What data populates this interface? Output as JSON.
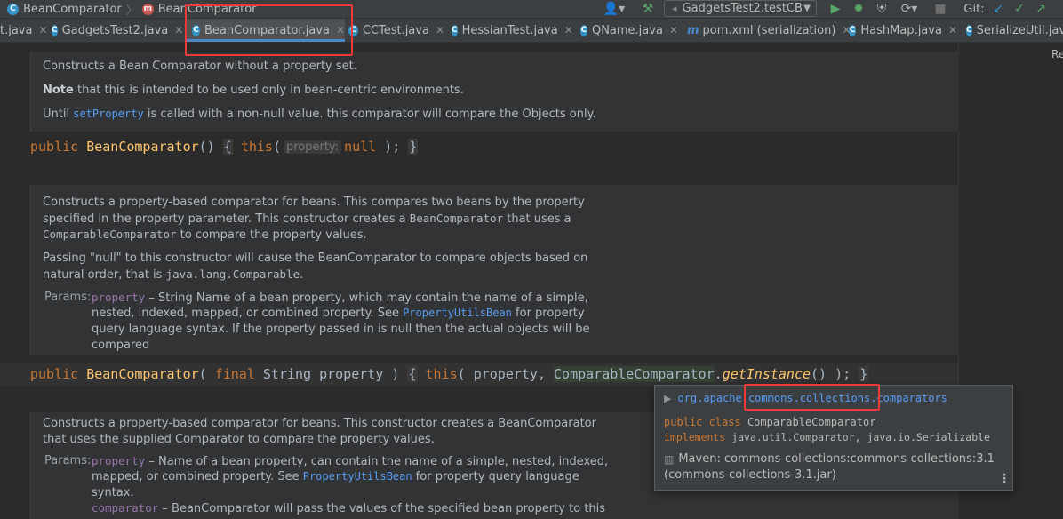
{
  "navbar": {
    "crumb_class": "BeanComparator",
    "crumb_method": "BeanComparator",
    "run_config": "GadgetsTest2.testCB",
    "vcs_label": "Git:"
  },
  "tabs": [
    {
      "label": "t.java"
    },
    {
      "label": "GadgetsTest2.java"
    },
    {
      "label": "BeanComparator.java"
    },
    {
      "label": "CCTest.java"
    },
    {
      "label": "HessianTest.java"
    },
    {
      "label": "QName.java"
    },
    {
      "label": "pom.xml (serialization)"
    },
    {
      "label": "HashMap.java"
    },
    {
      "label": "SerializeUtil.java"
    }
  ],
  "side_panel": {
    "label": "Re"
  },
  "docs": {
    "d1": {
      "line1": "Constructs a Bean Comparator without a property set.",
      "note_bold": "Note",
      "note_rest": " that this is intended to be used only in bean-centric environments.",
      "until": "Until ",
      "link": "setProperty",
      "until_rest": " is called with a non-null value. this comparator will compare the Objects only."
    },
    "d2": {
      "l1": "Constructs a property-based comparator for beans. This compares two beans by the property",
      "l2a": "specified in the property parameter. This constructor creates a ",
      "l2code": "BeanComparator",
      "l2b": " that uses a",
      "l3code": "ComparableComparator",
      "l3b": " to compare the property values.",
      "l4": "Passing \"null\" to this constructor will cause the BeanComparator to compare objects based on",
      "l5a": "natural order, that is ",
      "l5code": "java.lang.Comparable",
      "l5b": ".",
      "params_label": "Params:",
      "p_name": "property",
      "p1": " – String Name of a bean property, which may contain the name of a simple,",
      "p2a": "nested, indexed, mapped, or combined property. See ",
      "p2link": "PropertyUtilsBean",
      "p2b": " for property",
      "p3": "query language syntax. If the property passed in is null then the actual objects will be",
      "p4": "compared"
    },
    "d3": {
      "l1": "Constructs a property-based comparator for beans. This constructor creates a BeanComparator",
      "l2": "that uses the supplied Comparator to compare the property values.",
      "params_label": "Params:",
      "p_name": "property",
      "p1": " – Name of a bean property, can contain the name of a simple, nested, indexed,",
      "p2a": "mapped, or combined property. See ",
      "p2link": "PropertyUtilsBean",
      "p2b": " for property query language",
      "p3": "syntax.",
      "p4name": "comparator",
      "p4": " – BeanComparator will pass the values of the specified bean property to this"
    }
  },
  "code": {
    "line1": {
      "kw_public": "public",
      "name": "BeanComparator",
      "paren": "()",
      "lbrace": "{",
      "kw_this": "this",
      "open": "(",
      "hint": "property:",
      "kw_null": "null",
      "close": ");",
      "rbrace": "}"
    },
    "line2": {
      "kw_public": "public",
      "name": "BeanComparator",
      "open": "(",
      "kw_final": "final",
      "type": "String",
      "param": "property",
      "close": ")",
      "lbrace": "{",
      "kw_this": "this",
      "open2": "(",
      "arg": "property,",
      "cls": "ComparableComparator",
      "dot": ".",
      "method": "getInstance",
      "tail": "() );",
      "rbrace": "}"
    }
  },
  "popup": {
    "package": "org.apache.commons.collections.comparators",
    "decl1_kw": "public class",
    "decl1_name": "ComparableComparator",
    "decl2_kw": "implements",
    "decl2_types": "java.util.Comparator, java.io.Serializable",
    "maven_line1": "Maven: commons-collections:commons-collections:3.1",
    "maven_line2": "(commons-collections-3.1.jar)"
  },
  "colors": {
    "accent": "#4a88c7",
    "highlight": "#ea3a3a"
  }
}
